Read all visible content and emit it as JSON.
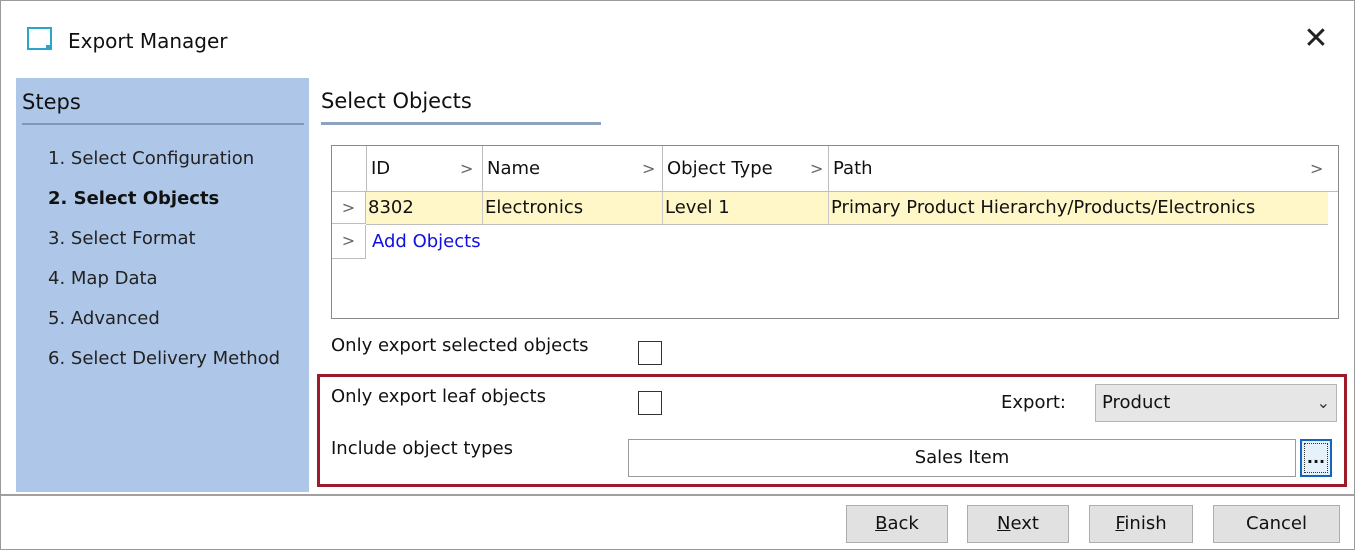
{
  "window": {
    "title": "Export Manager",
    "close_symbol": "✕"
  },
  "steps": {
    "header": "Steps",
    "items": [
      {
        "label": "1. Select Configuration",
        "active": false
      },
      {
        "label": "2. Select Objects",
        "active": true
      },
      {
        "label": "3. Select Format",
        "active": false
      },
      {
        "label": "4. Map Data",
        "active": false
      },
      {
        "label": "5. Advanced",
        "active": false
      },
      {
        "label": "6. Select Delivery Method",
        "active": false
      }
    ]
  },
  "section": {
    "title": "Select Objects"
  },
  "grid": {
    "columns": [
      "ID",
      "Name",
      "Object Type",
      "Path"
    ],
    "rows": [
      {
        "id": "8302",
        "name": "Electronics",
        "object_type": "Level 1",
        "path": "Primary Product Hierarchy/Products/Electronics"
      }
    ],
    "add_link": "Add Objects",
    "row_selected_color": "#fff7c7"
  },
  "options": {
    "only_selected_label": "Only export selected objects",
    "only_selected_checked": false,
    "only_leaf_label": "Only export leaf objects",
    "only_leaf_checked": false,
    "export_label": "Export:",
    "export_value": "Product",
    "include_types_label": "Include object types",
    "include_types_value": "Sales Item",
    "ellipsis": "..."
  },
  "buttons": {
    "back": {
      "label": "Back",
      "accel": "B",
      "rest": "ack"
    },
    "next": {
      "label": "Next",
      "accel": "N",
      "rest": "ext"
    },
    "finish": {
      "label": "Finish",
      "accel": "F",
      "rest": "inish"
    },
    "cancel": {
      "label": "Cancel"
    }
  },
  "colors": {
    "steps_bg": "#aec7e8",
    "highlight": "#9b1b2a",
    "link": "#1010e0"
  }
}
